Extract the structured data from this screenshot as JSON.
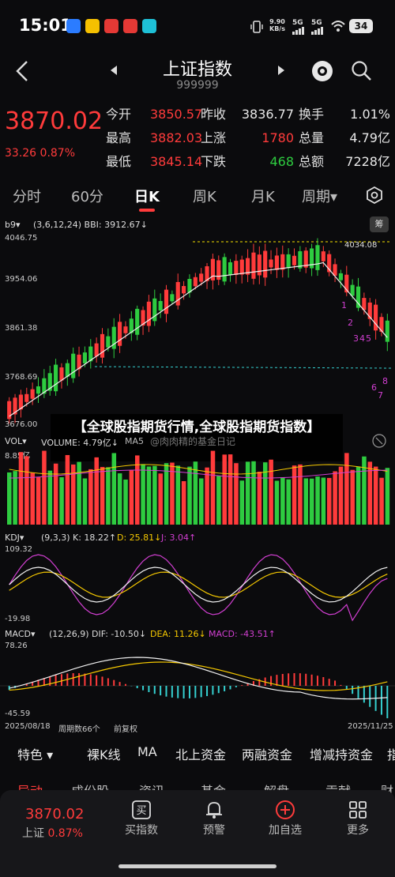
{
  "status": {
    "time": "15:01",
    "net_speed": "9.90",
    "net_unit": "KB/s",
    "sig1": "5G",
    "sig2": "5G",
    "battery": "34"
  },
  "header": {
    "title": "上证指数",
    "code": "999999"
  },
  "quote": {
    "price": "3870.02",
    "change": "33.26",
    "change_pct": "0.87%",
    "rows": [
      {
        "l1": "今开",
        "v1": "3850.57",
        "l2": "昨收",
        "v2": "3836.77",
        "l3": "换手",
        "v3": "1.01%"
      },
      {
        "l1": "最高",
        "v1": "3882.03",
        "l2": "上涨",
        "v2": "1780",
        "l3": "总量",
        "v3": "4.79亿"
      },
      {
        "l1": "最低",
        "v1": "3845.14",
        "l2": "下跌",
        "v2": "468",
        "l3": "总额",
        "v3": "7228亿"
      }
    ]
  },
  "tabs": [
    "分时",
    "60分",
    "日K",
    "周K",
    "月K",
    "周期▾"
  ],
  "chart_info": {
    "b9": "b9▾",
    "bbi": "(3,6,12,24) BBI: 3912.67↓",
    "notify": "筹",
    "y_top": "4046.75",
    "y_2": "3954.06",
    "y_3": "3861.38",
    "y_4": "3768.69",
    "y_bottom": "3676.00",
    "peak_label": "4034.08",
    "seq_labels": [
      "1",
      "2",
      "3",
      "4",
      "5",
      "6",
      "7",
      "8"
    ]
  },
  "overlay_text": "【全球股指期货行情,全球股指期货指数】",
  "vol": {
    "label": "VOL▾",
    "text": "VOLUME: 4.79亿↓",
    "ma": "MA5",
    "top": "8.85亿",
    "watermark": "@肉肉精的基金日记"
  },
  "kdj": {
    "label": "KDJ▾",
    "params": "(9,3,3)",
    "k": "K: 18.22↑",
    "d": "D: 25.81↓",
    "j": "J: 3.04↑",
    "top": "109.32",
    "bottom": "-19.98"
  },
  "macd": {
    "label": "MACD▾",
    "params": "(12,26,9)",
    "dif": "DIF: -10.50↓",
    "dea": "DEA: 11.26↓",
    "macd": "MACD: -43.51↑",
    "top": "78.26",
    "bottom": "-45.59"
  },
  "dates": {
    "start": "2025/08/18",
    "period": "周期数66个",
    "fq": "前复权",
    "end": "2025/11/25"
  },
  "toolbar": [
    "特色 ▾",
    "裸K线",
    "MA",
    "北上资金",
    "两融资金",
    "增减持资金",
    "指"
  ],
  "categories": [
    "异动",
    "成份股",
    "资讯",
    "基金",
    "解盘",
    "贡献",
    "财"
  ],
  "bottom": {
    "price": "3870.02",
    "label": "上证",
    "pct": "0.87%",
    "items": [
      "买指数",
      "预警",
      "加自选",
      "更多"
    ]
  },
  "colors": {
    "up": "#ff3b3b",
    "down": "#2ecc40",
    "accent": "#ff3b3b"
  }
}
